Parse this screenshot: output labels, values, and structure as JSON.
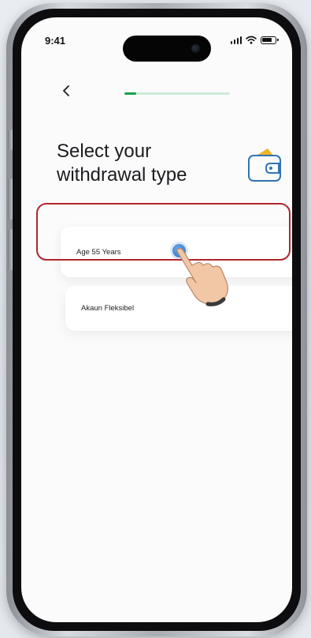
{
  "status_bar": {
    "time": "9:41"
  },
  "header": {
    "progress_fraction": 0.11
  },
  "title": "Select your withdrawal type",
  "options": [
    {
      "label": "Age 55 Years",
      "highlighted": true
    },
    {
      "label": "Akaun Fleksibel",
      "highlighted": false
    }
  ],
  "colors": {
    "accent": "#18a34a",
    "progress_track": "#cdebd6",
    "highlight": "#b3262c",
    "wallet": "#2f73b8",
    "tap_indicator": "#2f71c8"
  },
  "icons": [
    "back-chevron-icon",
    "wallet-icon",
    "signal-icon",
    "wifi-icon",
    "battery-icon",
    "pointing-hand-icon"
  ]
}
